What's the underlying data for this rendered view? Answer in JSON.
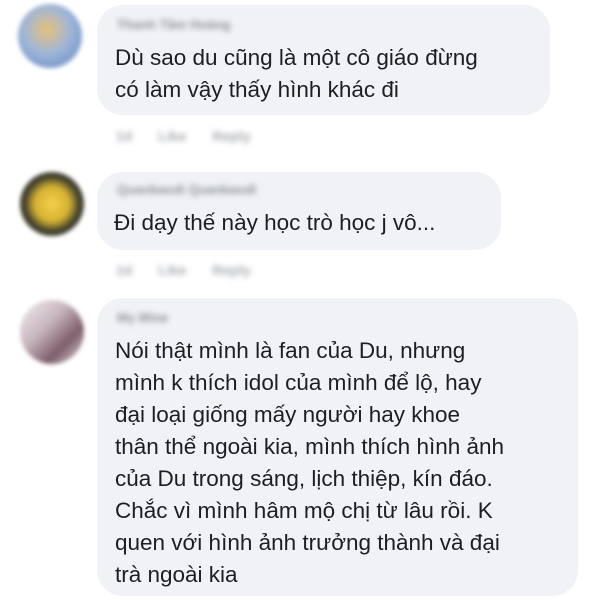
{
  "comments": [
    {
      "author": "Thanh Tâm Hoàng",
      "text": "Dù sao du cũng là một cô giáo đừng\ncó làm vậy thấy hình khác đi",
      "time": "1d",
      "like": "Like",
      "reply": "Reply"
    },
    {
      "author": "Quanbaodi Quanbaodi",
      "text": "Đi dạy thế này học trò học j vô...",
      "time": "1d",
      "like": "Like",
      "reply": "Reply"
    },
    {
      "author": "My Mine",
      "text": "Nói thật mình là fan của Du, nhưng\nmình k thích idol của mình để lộ, hay\nđại loại giống mấy người hay khoe\nthân thể ngoài kia, mình thích hình ảnh\ncủa Du trong sáng, lịch thiệp, kín đáo.\nChắc vì mình hâm mộ chị từ lâu rồi. K\nquen với hình ảnh trưởng thành và đại\ntrà ngoài kia"
    }
  ]
}
